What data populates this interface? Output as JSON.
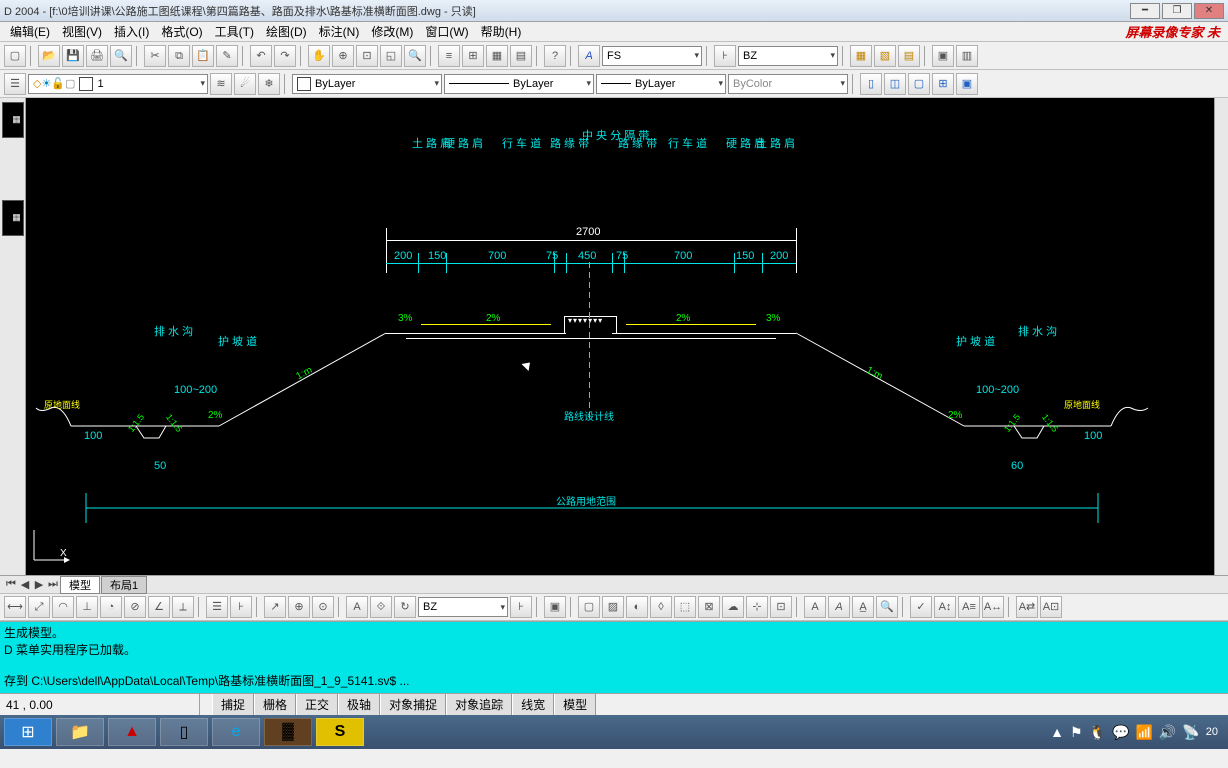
{
  "title": "D 2004 - [f:\\0培训讲课\\公路施工图纸课程\\第四篇路基、路面及排水\\路基标准横断面图.dwg - 只读]",
  "menu": {
    "m0": "编辑(E)",
    "m1": "视图(V)",
    "m2": "插入(I)",
    "m3": "格式(O)",
    "m4": "工具(T)",
    "m5": "绘图(D)",
    "m6": "标注(N)",
    "m7": "修改(M)",
    "m8": "窗口(W)",
    "m9": "帮助(H)"
  },
  "watermark": "屏幕录像专家 未",
  "prop": {
    "layer": "1",
    "colorByLayer": "ByLayer",
    "linetype": "ByLayer",
    "lineweight": "ByLayer",
    "plotstyle": "ByColor",
    "textstyle": "FS",
    "dimstyle": "BZ",
    "dimstyle2": "BZ"
  },
  "tabs": {
    "t0": "模型",
    "t1": "布局1"
  },
  "cmd": {
    "l1": "生成模型。",
    "l2": "D 菜单实用程序已加载。",
    "l3": "存到 C:\\Users\\dell\\AppData\\Local\\Temp\\路基标准横断面图_1_9_5141.sv$ ..."
  },
  "status": {
    "coord": "41 , 0.00",
    "s0": "捕捉",
    "s1": "栅格",
    "s2": "正交",
    "s3": "极轴",
    "s4": "对象捕捉",
    "s5": "对象追踪",
    "s6": "线宽",
    "s7": "模型"
  },
  "clock": "20",
  "labels": {
    "tl0": "土\n路\n肩",
    "tl1": "硬\n路\n肩",
    "tl2": "行\n车\n道",
    "tl3": "路\n缘\n带",
    "tl4": "中\n央\n分\n隔\n带",
    "tl5": "路\n缘\n带",
    "tl6": "行\n车\n道",
    "tl7": "硬\n路\n肩",
    "tl8": "土\n路\n肩",
    "dim_total": "2700",
    "d0": "200",
    "d1": "150",
    "d2": "700",
    "d3": "75",
    "d4": "450",
    "d5": "75",
    "d6": "700",
    "d7": "150",
    "d8": "200",
    "s0": "3%",
    "s1": "2%",
    "s2": "2%",
    "s3": "3%",
    "slope": "1:m",
    "slope_r": "1:m",
    "pw_l": "排\n水\n沟",
    "hp_l": "护\n坡\n道",
    "hp_r": "护\n坡\n道",
    "pw_r": "排\n水\n沟",
    "yd_l": "原地面线",
    "yd_r": "原地面线",
    "center": "路线设计线",
    "bottom": "公路用地范围",
    "pl": "2%",
    "pr": "2%",
    "pll": "1:1.5",
    "plr": "1:1.5",
    "hl": "100~200",
    "hr": "100~200",
    "dim100l": "100",
    "dim100r": "100",
    "dim50l": "50",
    "dim60r": "60",
    "rot1": "1:1.5",
    "rot2": "1:1.5",
    "rot3": "1:1.5",
    "rot4": "1:1.5"
  }
}
